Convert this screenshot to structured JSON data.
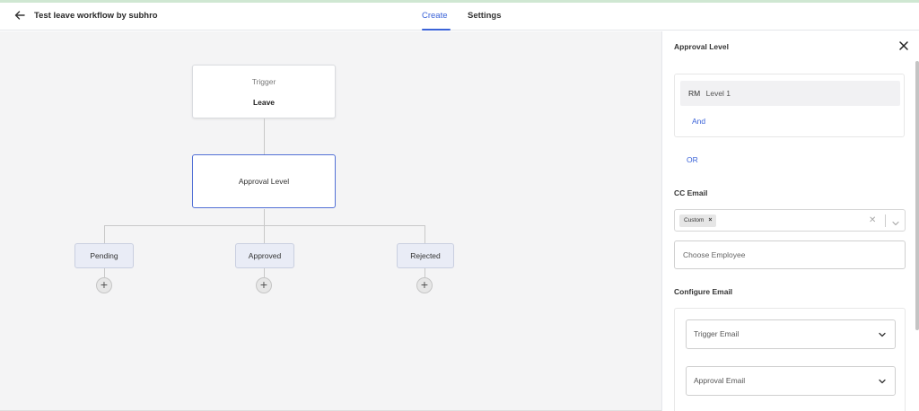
{
  "header": {
    "title": "Test leave workflow by subhro",
    "tabs": [
      {
        "label": "Create",
        "active": true
      },
      {
        "label": "Settings",
        "active": false
      }
    ]
  },
  "flow": {
    "trigger": {
      "label": "Trigger",
      "value": "Leave"
    },
    "approval_node": "Approval Level",
    "outcomes": [
      "Pending",
      "Approved",
      "Rejected"
    ]
  },
  "panel": {
    "title": "Approval Level",
    "approver": {
      "role": "RM",
      "level": "Level 1"
    },
    "and_link": "And",
    "or_link": "OR",
    "cc_email": {
      "label": "CC Email",
      "tag": "Custom",
      "tag_remove": "×"
    },
    "employee_placeholder": "Choose Employee",
    "configure_email": {
      "label": "Configure Email",
      "trigger_email": "Trigger Email",
      "approval_email": "Approval Email"
    }
  },
  "colors": {
    "accent": "#3b63d8",
    "canvas_bg": "#f4f4f5",
    "approval_border": "#5270d6",
    "chip_bg": "#e9ecf6"
  }
}
